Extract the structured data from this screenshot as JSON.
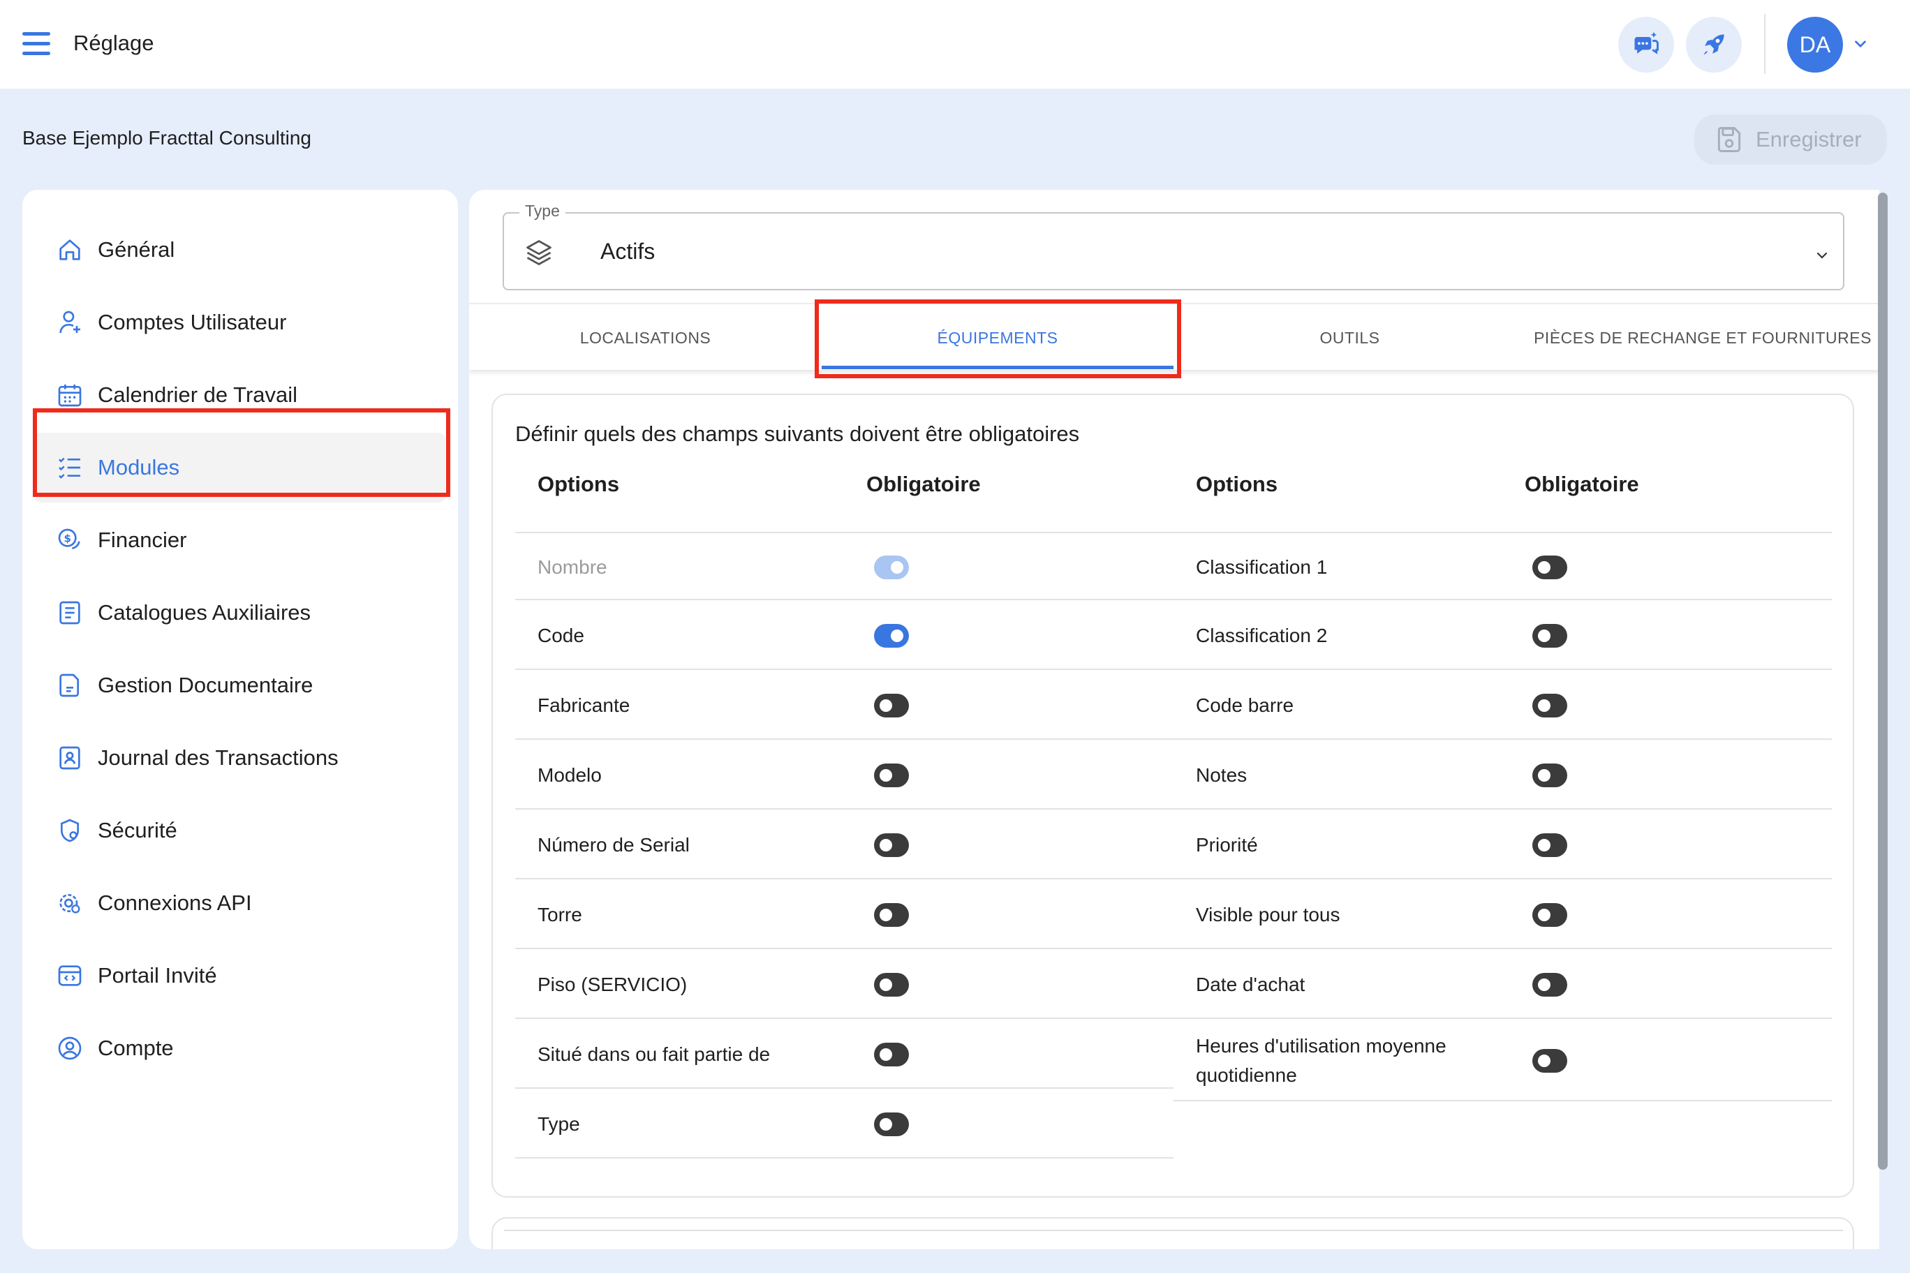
{
  "app": {
    "title": "Réglage",
    "user_initials": "DA"
  },
  "header": {
    "base_name": "Base Ejemplo Fracttal Consulting",
    "save_label": "Enregistrer"
  },
  "sidebar": {
    "items": [
      {
        "label": "Général",
        "icon": "home-icon"
      },
      {
        "label": "Comptes Utilisateur",
        "icon": "user-add-icon"
      },
      {
        "label": "Calendrier de Travail",
        "icon": "calendar-icon"
      },
      {
        "label": "Modules",
        "icon": "checklist-icon",
        "active": true
      },
      {
        "label": "Financier",
        "icon": "dollar-coin-icon"
      },
      {
        "label": "Catalogues Auxiliaires",
        "icon": "catalog-icon"
      },
      {
        "label": "Gestion Documentaire",
        "icon": "document-icon"
      },
      {
        "label": "Journal des Transactions",
        "icon": "badge-icon"
      },
      {
        "label": "Sécurité",
        "icon": "shield-icon"
      },
      {
        "label": "Connexions API",
        "icon": "api-gear-icon"
      },
      {
        "label": "Portail Invité",
        "icon": "portal-icon"
      },
      {
        "label": "Compte",
        "icon": "account-icon"
      }
    ]
  },
  "type_select": {
    "legend": "Type",
    "value": "Actifs",
    "icon": "layers-icon"
  },
  "tabs": [
    {
      "label": "LOCALISATIONS"
    },
    {
      "label": "ÉQUIPEMENTS",
      "active": true
    },
    {
      "label": "OUTILS"
    },
    {
      "label": "PIÈCES DE RECHANGE ET FOURNITURES"
    }
  ],
  "card": {
    "heading": "Définir quels des champs suivants doivent être obligatoires",
    "col_options": "Options",
    "col_required": "Obligatoire",
    "left_rows": [
      {
        "label": "Nombre",
        "required": true,
        "disabled": true
      },
      {
        "label": "Code",
        "required": true
      },
      {
        "label": "Fabricante",
        "required": false
      },
      {
        "label": "Modelo",
        "required": false
      },
      {
        "label": "Número de Serial",
        "required": false
      },
      {
        "label": "Torre",
        "required": false
      },
      {
        "label": "Piso (SERVICIO)",
        "required": false
      },
      {
        "label": "Situé dans ou fait partie de",
        "required": false
      },
      {
        "label": "Type",
        "required": false
      }
    ],
    "right_rows": [
      {
        "label": "Classification 1",
        "required": false
      },
      {
        "label": "Classification 2",
        "required": false
      },
      {
        "label": "Code barre",
        "required": false
      },
      {
        "label": "Notes",
        "required": false
      },
      {
        "label": "Priorité",
        "required": false
      },
      {
        "label": "Visible pour tous",
        "required": false
      },
      {
        "label": "Date d'achat",
        "required": false
      },
      {
        "label": "Heures d'utilisation moyenne quotidienne",
        "required": false
      }
    ]
  },
  "colors": {
    "accent": "#3a76e0",
    "highlight": "#ee2b1c",
    "background": "#e6eefb"
  }
}
